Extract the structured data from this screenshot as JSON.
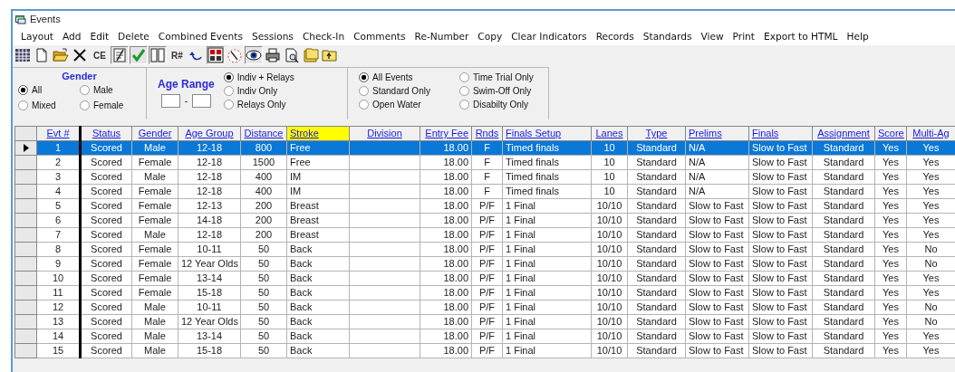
{
  "window": {
    "title": "Events"
  },
  "menu": [
    "Layout",
    "Add",
    "Edit",
    "Delete",
    "Combined Events",
    "Sessions",
    "Check-In",
    "Comments",
    "Re-Number",
    "Copy",
    "Clear Indicators",
    "Records",
    "Standards",
    "View",
    "Print",
    "Export to HTML",
    "Help"
  ],
  "toolbar": [
    {
      "kind": "grid",
      "pressed": false
    },
    {
      "kind": "doc",
      "pressed": false
    },
    {
      "kind": "folder-open",
      "pressed": false
    },
    {
      "kind": "x",
      "pressed": false
    },
    {
      "kind": "text",
      "label": "CE",
      "pressed": false
    },
    {
      "kind": "notepad",
      "pressed": true
    },
    {
      "kind": "check",
      "pressed": true
    },
    {
      "kind": "columns",
      "pressed": true
    },
    {
      "kind": "text",
      "label": "R#",
      "pressed": false
    },
    {
      "kind": "undo",
      "pressed": false
    },
    {
      "kind": "numbers",
      "pressed": true
    },
    {
      "kind": "clock",
      "pressed": false
    },
    {
      "kind": "eye",
      "pressed": true
    },
    {
      "kind": "printer",
      "pressed": false
    },
    {
      "kind": "preview",
      "pressed": false
    },
    {
      "kind": "folders",
      "pressed": false
    },
    {
      "kind": "folder-up",
      "pressed": false
    }
  ],
  "gender": {
    "title": "Gender",
    "options": [
      {
        "label": "All",
        "selected": true
      },
      {
        "label": "Male",
        "selected": false
      },
      {
        "label": "Mixed",
        "selected": false
      },
      {
        "label": "Female",
        "selected": false
      }
    ]
  },
  "age_range": {
    "title": "Age Range",
    "separator": "-"
  },
  "entry_type": [
    {
      "label": "Indiv + Relays",
      "selected": true
    },
    {
      "label": "Indiv Only",
      "selected": false
    },
    {
      "label": "Relays Only",
      "selected": false
    }
  ],
  "event_filter": [
    {
      "label": "All Events",
      "selected": true
    },
    {
      "label": "Standard Only",
      "selected": false
    },
    {
      "label": "Open Water",
      "selected": false
    },
    {
      "label": "Time Trial Only",
      "selected": false
    },
    {
      "label": "Swim-Off Only",
      "selected": false
    },
    {
      "label": "Disabilty Only",
      "selected": false
    }
  ],
  "table": {
    "columns": [
      {
        "label": "Evt #",
        "sorted": false
      },
      {
        "label": "Status",
        "sorted": false
      },
      {
        "label": "Gender",
        "sorted": false
      },
      {
        "label": "Age Group",
        "sorted": false
      },
      {
        "label": "Distance",
        "sorted": false
      },
      {
        "label": "Stroke",
        "sorted": true
      },
      {
        "label": "Division",
        "sorted": false
      },
      {
        "label": "Entry Fee",
        "sorted": false
      },
      {
        "label": "Rnds",
        "sorted": false
      },
      {
        "label": "Finals Setup",
        "sorted": false
      },
      {
        "label": "Lanes",
        "sorted": false
      },
      {
        "label": "Type",
        "sorted": false
      },
      {
        "label": "Prelims",
        "sorted": false
      },
      {
        "label": "Finals",
        "sorted": false
      },
      {
        "label": "Assignment",
        "sorted": false
      },
      {
        "label": "Score",
        "sorted": false
      },
      {
        "label": "Multi-Ag",
        "sorted": false
      }
    ],
    "rows": [
      {
        "selected": true,
        "cells": [
          "1",
          "Scored",
          "Male",
          "12-18",
          "800",
          "Free",
          "",
          "18.00",
          "F",
          "Timed finals",
          "10",
          "Standard",
          "N/A",
          "Slow to Fast",
          "Standard",
          "Yes",
          "Yes"
        ]
      },
      {
        "selected": false,
        "cells": [
          "2",
          "Scored",
          "Female",
          "12-18",
          "1500",
          "Free",
          "",
          "18.00",
          "F",
          "Timed finals",
          "10",
          "Standard",
          "N/A",
          "Slow to Fast",
          "Standard",
          "Yes",
          "Yes"
        ]
      },
      {
        "selected": false,
        "cells": [
          "3",
          "Scored",
          "Male",
          "12-18",
          "400",
          "IM",
          "",
          "18.00",
          "F",
          "Timed finals",
          "10",
          "Standard",
          "N/A",
          "Slow to Fast",
          "Standard",
          "Yes",
          "Yes"
        ]
      },
      {
        "selected": false,
        "cells": [
          "4",
          "Scored",
          "Female",
          "12-18",
          "400",
          "IM",
          "",
          "18.00",
          "F",
          "Timed finals",
          "10",
          "Standard",
          "N/A",
          "Slow to Fast",
          "Standard",
          "Yes",
          "Yes"
        ]
      },
      {
        "selected": false,
        "cells": [
          "5",
          "Scored",
          "Female",
          "12-13",
          "200",
          "Breast",
          "",
          "18.00",
          "P/F",
          "1 Final",
          "10/10",
          "Standard",
          "Slow to Fast",
          "Slow to Fast",
          "Standard",
          "Yes",
          "Yes"
        ]
      },
      {
        "selected": false,
        "cells": [
          "6",
          "Scored",
          "Female",
          "14-18",
          "200",
          "Breast",
          "",
          "18.00",
          "P/F",
          "1 Final",
          "10/10",
          "Standard",
          "Slow to Fast",
          "Slow to Fast",
          "Standard",
          "Yes",
          "Yes"
        ]
      },
      {
        "selected": false,
        "cells": [
          "7",
          "Scored",
          "Male",
          "12-18",
          "200",
          "Breast",
          "",
          "18.00",
          "P/F",
          "1 Final",
          "10/10",
          "Standard",
          "Slow to Fast",
          "Slow to Fast",
          "Standard",
          "Yes",
          "Yes"
        ]
      },
      {
        "selected": false,
        "cells": [
          "8",
          "Scored",
          "Female",
          "10-11",
          "50",
          "Back",
          "",
          "18.00",
          "P/F",
          "1 Final",
          "10/10",
          "Standard",
          "Slow to Fast",
          "Slow to Fast",
          "Standard",
          "Yes",
          "No"
        ]
      },
      {
        "selected": false,
        "cells": [
          "9",
          "Scored",
          "Female",
          "12 Year Olds",
          "50",
          "Back",
          "",
          "18.00",
          "P/F",
          "1 Final",
          "10/10",
          "Standard",
          "Slow to Fast",
          "Slow to Fast",
          "Standard",
          "Yes",
          "No"
        ]
      },
      {
        "selected": false,
        "cells": [
          "10",
          "Scored",
          "Female",
          "13-14",
          "50",
          "Back",
          "",
          "18.00",
          "P/F",
          "1 Final",
          "10/10",
          "Standard",
          "Slow to Fast",
          "Slow to Fast",
          "Standard",
          "Yes",
          "Yes"
        ]
      },
      {
        "selected": false,
        "cells": [
          "11",
          "Scored",
          "Female",
          "15-18",
          "50",
          "Back",
          "",
          "18.00",
          "P/F",
          "1 Final",
          "10/10",
          "Standard",
          "Slow to Fast",
          "Slow to Fast",
          "Standard",
          "Yes",
          "Yes"
        ]
      },
      {
        "selected": false,
        "cells": [
          "12",
          "Scored",
          "Male",
          "10-11",
          "50",
          "Back",
          "",
          "18.00",
          "P/F",
          "1 Final",
          "10/10",
          "Standard",
          "Slow to Fast",
          "Slow to Fast",
          "Standard",
          "Yes",
          "No"
        ]
      },
      {
        "selected": false,
        "cells": [
          "13",
          "Scored",
          "Male",
          "12 Year Olds",
          "50",
          "Back",
          "",
          "18.00",
          "P/F",
          "1 Final",
          "10/10",
          "Standard",
          "Slow to Fast",
          "Slow to Fast",
          "Standard",
          "Yes",
          "No"
        ]
      },
      {
        "selected": false,
        "cells": [
          "14",
          "Scored",
          "Male",
          "13-14",
          "50",
          "Back",
          "",
          "18.00",
          "P/F",
          "1 Final",
          "10/10",
          "Standard",
          "Slow to Fast",
          "Slow to Fast",
          "Standard",
          "Yes",
          "Yes"
        ]
      },
      {
        "selected": false,
        "cells": [
          "15",
          "Scored",
          "Male",
          "15-18",
          "50",
          "Back",
          "",
          "18.00",
          "P/F",
          "1 Final",
          "10/10",
          "Standard",
          "Slow to Fast",
          "Slow to Fast",
          "Standard",
          "Yes",
          "Yes"
        ]
      }
    ]
  }
}
